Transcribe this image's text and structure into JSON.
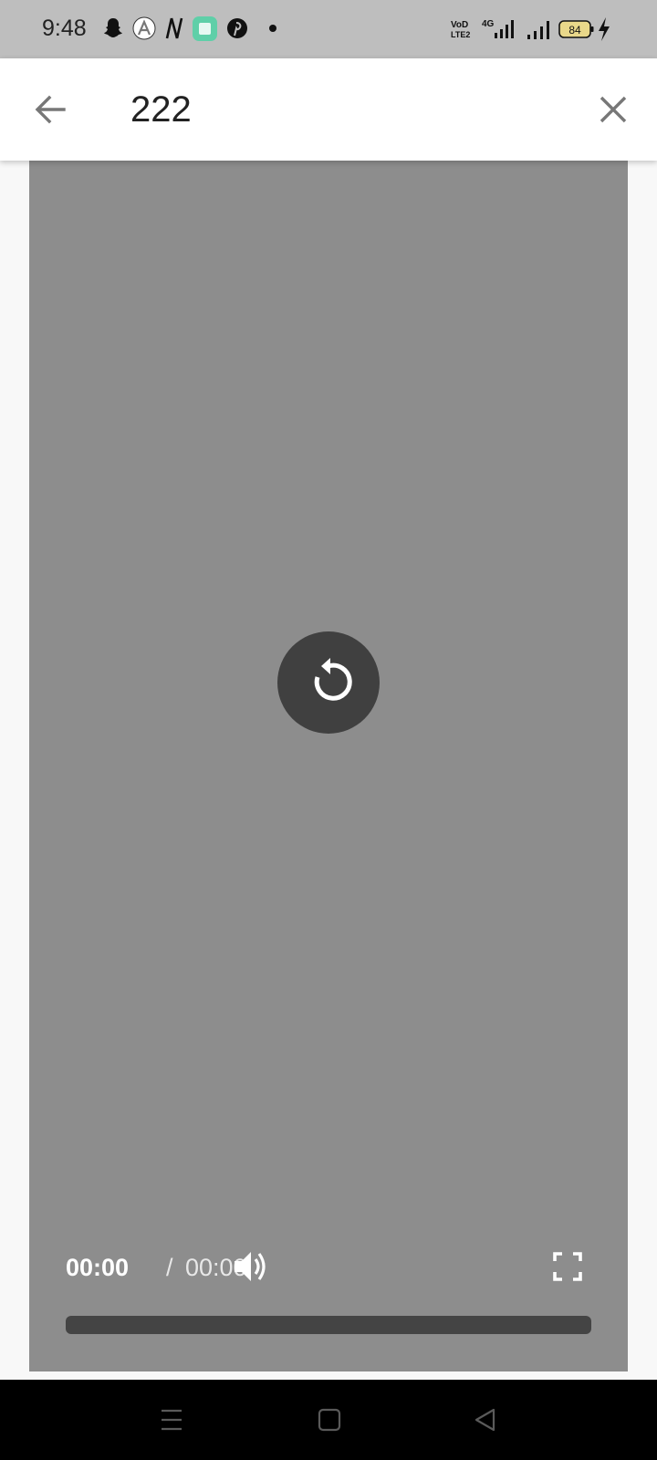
{
  "status_bar": {
    "time": "9:48",
    "battery_level": "84",
    "network_label": "4G",
    "volte_label_top": "VoD",
    "volte_label_bottom": "LTE2"
  },
  "app_bar": {
    "title": "222"
  },
  "player": {
    "current_time": "00:00",
    "separator": "/",
    "total_time": "00:00",
    "progress": 0,
    "state": "ended",
    "background_color": "#8d8d8d"
  },
  "icons": {
    "back": "arrow-left",
    "close": "close-x",
    "replay": "replay",
    "volume": "volume-up",
    "fullscreen": "fullscreen",
    "nav_menu": "menu",
    "nav_home": "square",
    "nav_back": "triangle-left"
  }
}
